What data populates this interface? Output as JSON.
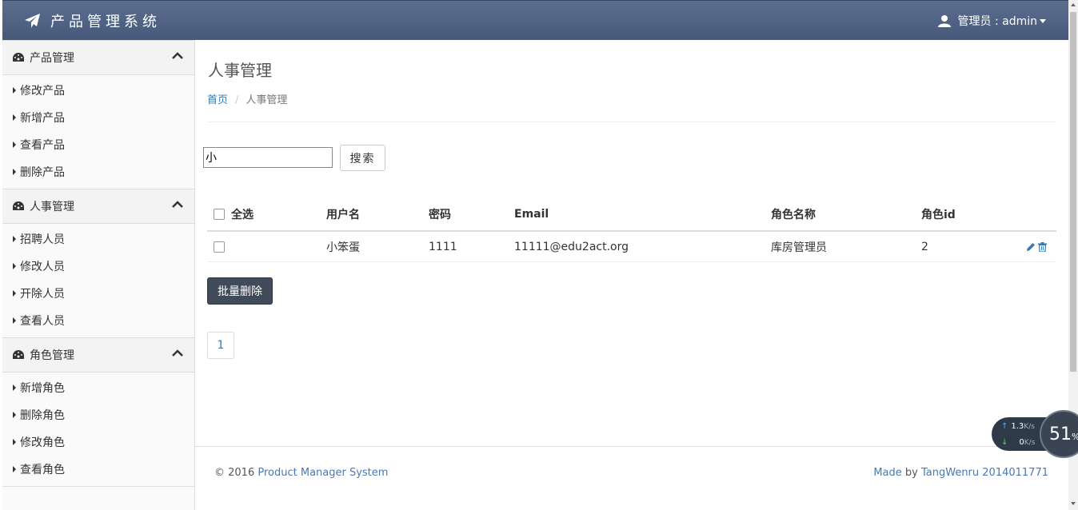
{
  "app": {
    "brand": "产品管理系统",
    "user_label": "管理员 : admin"
  },
  "sidebar": {
    "sections": [
      {
        "title": "产品管理",
        "items": [
          "修改产品",
          "新增产品",
          "查看产品",
          "删除产品"
        ]
      },
      {
        "title": "人事管理",
        "items": [
          "招聘人员",
          "修改人员",
          "开除人员",
          "查看人员"
        ]
      },
      {
        "title": "角色管理",
        "items": [
          "新增角色",
          "删除角色",
          "修改角色",
          "查看角色"
        ]
      }
    ]
  },
  "main": {
    "page_title": "人事管理",
    "breadcrumb": {
      "home": "首页",
      "separator": "/",
      "current": "人事管理"
    },
    "search": {
      "value": "小",
      "button": "搜索"
    },
    "table": {
      "headers": {
        "select_all": "全选",
        "username": "用户名",
        "password": "密码",
        "email": "Email",
        "role_name": "角色名称",
        "role_id": "角色id"
      },
      "rows": [
        {
          "username": "小笨蛋",
          "password": "1111",
          "email": "11111@edu2act.org",
          "role_name": "库房管理员",
          "role_id": "2"
        }
      ]
    },
    "batch_delete": "批量删除",
    "pagination": [
      "1"
    ]
  },
  "footer": {
    "copyright": "© 2016",
    "product_link": "Product Manager System",
    "made": "Made",
    "by": "by",
    "author_link": "TangWenru 2014011771"
  },
  "net_widget": {
    "upload": "1.3",
    "download": "0",
    "unit": "K/s",
    "percent": "51",
    "percent_sign": "%"
  },
  "colors": {
    "topbar": "#4f6282",
    "accent_link": "#337ab7",
    "batch_button": "#414a59"
  }
}
